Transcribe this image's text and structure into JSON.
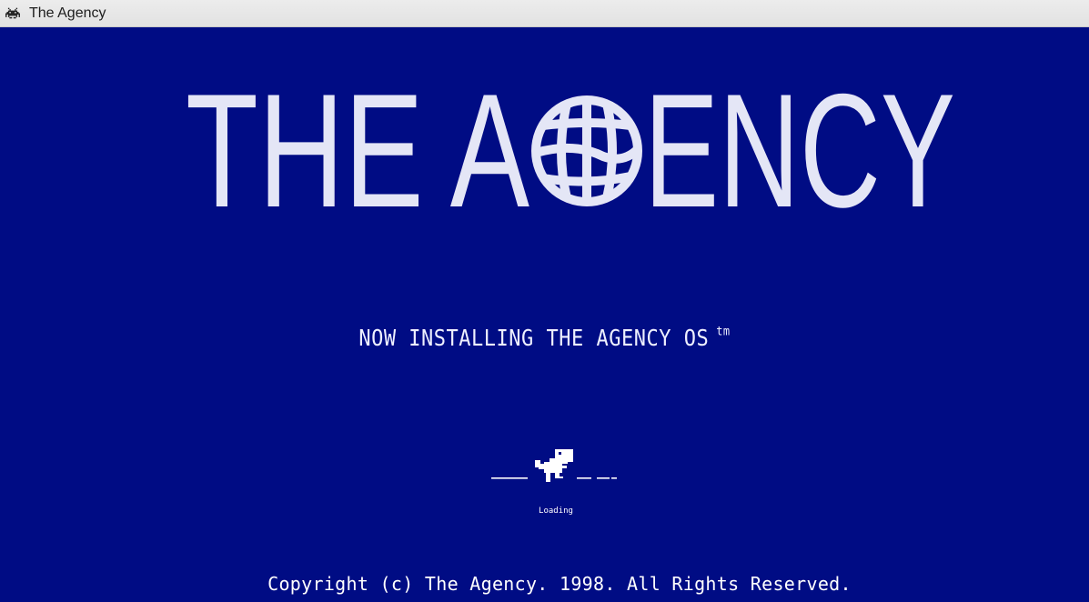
{
  "window": {
    "title": "The Agency",
    "icon": "space-invader-icon"
  },
  "splash": {
    "logo_left": "THE A",
    "logo_right": "ENCY",
    "logo_globe_icon": "globe-icon",
    "install_message": "NOW INSTALLING THE AGENCY OS",
    "trademark": "tm",
    "loader_icon": "dinosaur-icon",
    "loading_label": "Loading",
    "copyright": "Copyright (c) The Agency.  1998. All Rights Reserved."
  },
  "colors": {
    "background": "#000c84",
    "text": "#ffffff",
    "logo": "#e4e6f6"
  }
}
